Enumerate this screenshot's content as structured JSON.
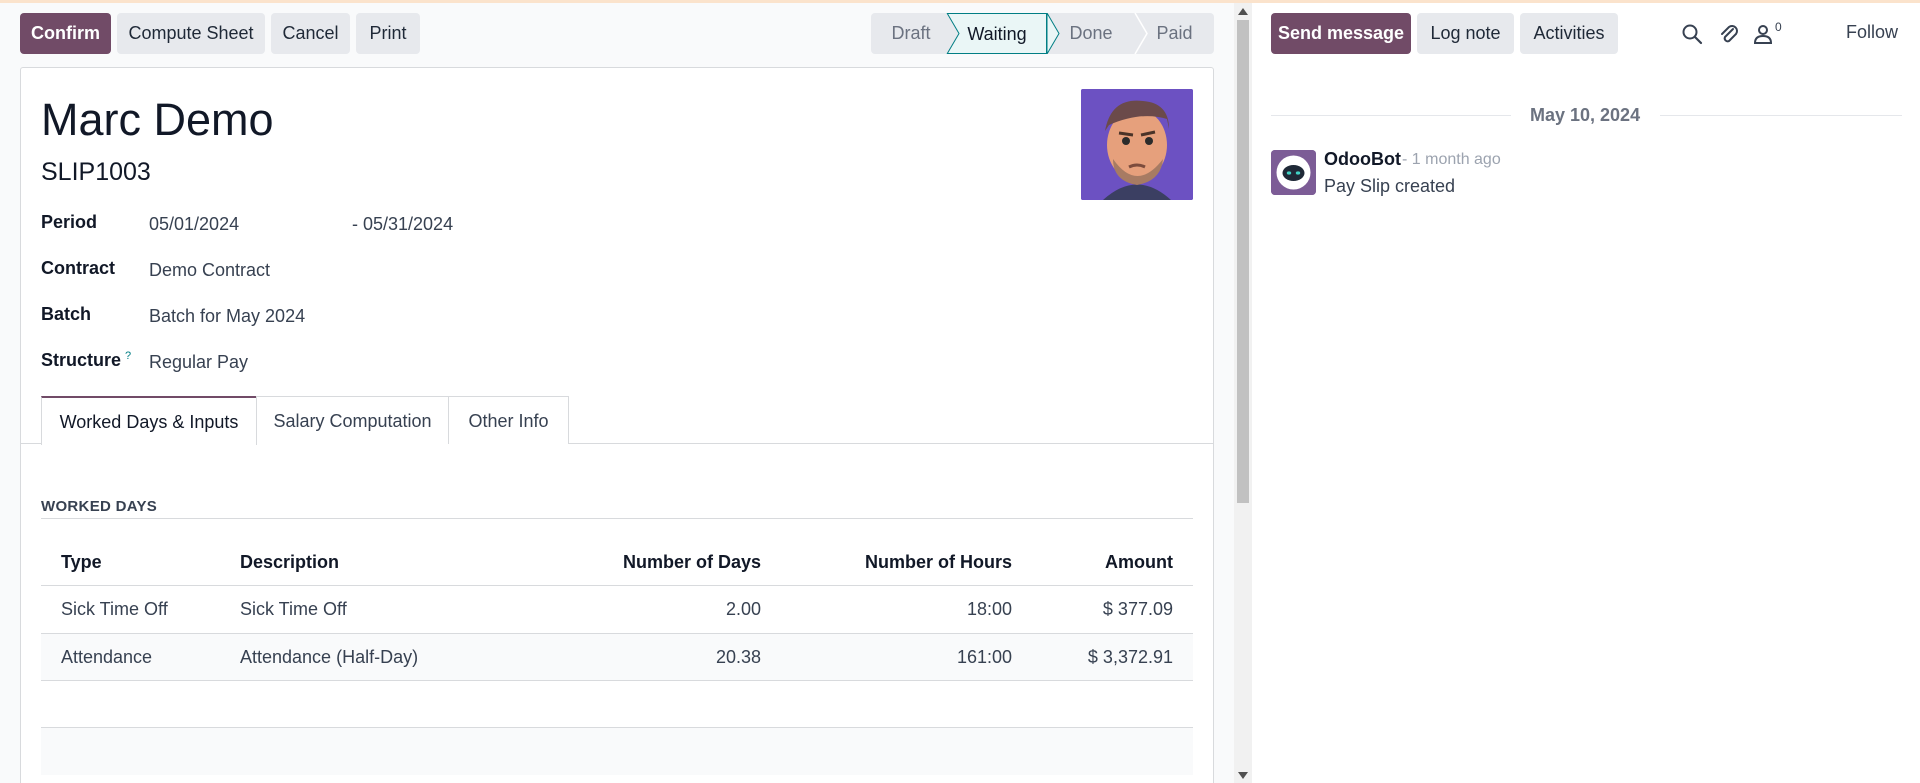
{
  "toolbar": {
    "confirm": "Confirm",
    "compute_sheet": "Compute Sheet",
    "cancel": "Cancel",
    "print": "Print"
  },
  "statusbar": {
    "stages": [
      "Draft",
      "Waiting",
      "Done",
      "Paid"
    ],
    "active": "Waiting"
  },
  "payslip": {
    "employee_name": "Marc Demo",
    "reference": "SLIP1003",
    "period_label": "Period",
    "period_from": "05/01/2024",
    "period_to": "- 05/31/2024",
    "contract_label": "Contract",
    "contract_value": "Demo Contract",
    "batch_label": "Batch",
    "batch_value": "Batch for May 2024",
    "structure_label": "Structure",
    "structure_help": "?",
    "structure_value": "Regular Pay"
  },
  "tabs": [
    "Worked Days & Inputs",
    "Salary Computation",
    "Other Info"
  ],
  "worked_days": {
    "title": "WORKED DAYS",
    "columns": [
      "Type",
      "Description",
      "Number of Days",
      "Number of Hours",
      "Amount"
    ],
    "rows": [
      {
        "type": "Sick Time Off",
        "description": "Sick Time Off",
        "days": "2.00",
        "hours": "18:00",
        "amount": "$ 377.09"
      },
      {
        "type": "Attendance",
        "description": "Attendance (Half-Day)",
        "days": "20.38",
        "hours": "161:00",
        "amount": "$ 3,372.91"
      }
    ]
  },
  "chatter": {
    "send_message": "Send message",
    "log_note": "Log note",
    "activities": "Activities",
    "follower_count": "0",
    "follow": "Follow",
    "date": "May 10, 2024",
    "author": "OdooBot",
    "time_ago": "- 1 month ago",
    "message": "Pay Slip created"
  },
  "colors": {
    "primary": "#714b67",
    "active_stage_border": "#017e84"
  }
}
